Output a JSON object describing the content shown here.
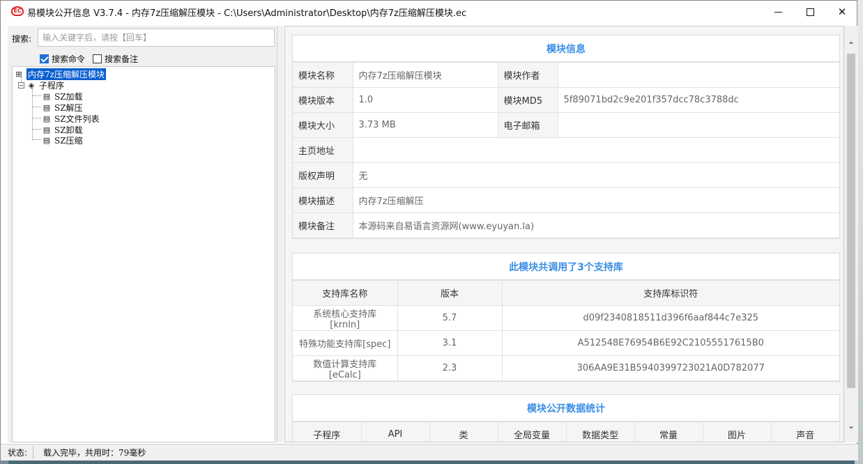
{
  "window": {
    "title": "易模块公开信息 V3.7.4 - 内存7z压缩解压模块 - C:\\Users\\Administrator\\Desktop\\内存7z压缩解压模块.ec",
    "icon": "ec-logo-icon"
  },
  "search": {
    "label": "搜索:",
    "placeholder": "输入关键字后，请按【回车】",
    "value": "",
    "search_command_label": "搜索命令",
    "search_command_checked": true,
    "search_remark_label": "搜索备注",
    "search_remark_checked": false
  },
  "tree": {
    "root": "内存7z压缩解压模块",
    "group": "子程序",
    "children": [
      "SZ加载",
      "SZ解压",
      "SZ文件列表",
      "SZ卸载",
      "SZ压缩"
    ]
  },
  "module_info": {
    "title": "模块信息",
    "rows": [
      {
        "k1": "模块名称",
        "v1": "内存7z压缩解压模块",
        "k2": "模块作者",
        "v2": ""
      },
      {
        "k1": "模块版本",
        "v1": "1.0",
        "k2": "模块MD5",
        "v2": "5f89071bd2c9e201f357dcc78c3788dc"
      },
      {
        "k1": "模块大小",
        "v1": "3.73 MB",
        "k2": "电子邮箱",
        "v2": ""
      },
      {
        "k1": "主页地址",
        "v1": ""
      },
      {
        "k1": "版权声明",
        "v1": "无"
      },
      {
        "k1": "模块描述",
        "v1": "内存7z压缩解压"
      },
      {
        "k1": "模块备注",
        "v1": "本源码来自易语言资源网(www.eyuyan.la)"
      }
    ]
  },
  "libraries": {
    "title": "此模块共调用了3个支持库",
    "headers": [
      "支持库名称",
      "版本",
      "支持库标识符"
    ],
    "rows": [
      {
        "name": "系统核心支持库[krnln]",
        "version": "5.7",
        "id": "d09f2340818511d396f6aaf844c7e325"
      },
      {
        "name": "特殊功能支持库[spec]",
        "version": "3.1",
        "id": "A512548E76954B6E92C21055517615B0"
      },
      {
        "name": "数值计算支持库[eCalc]",
        "version": "2.3",
        "id": "306AA9E31B5940399723021A0D782077"
      }
    ]
  },
  "stats": {
    "title": "模块公开数据统计",
    "headers": [
      "子程序",
      "API",
      "类",
      "全局变量",
      "数据类型",
      "常量",
      "图片",
      "声音"
    ]
  },
  "status": {
    "label": "状态:",
    "text": "载入完毕，共用时：79毫秒"
  }
}
